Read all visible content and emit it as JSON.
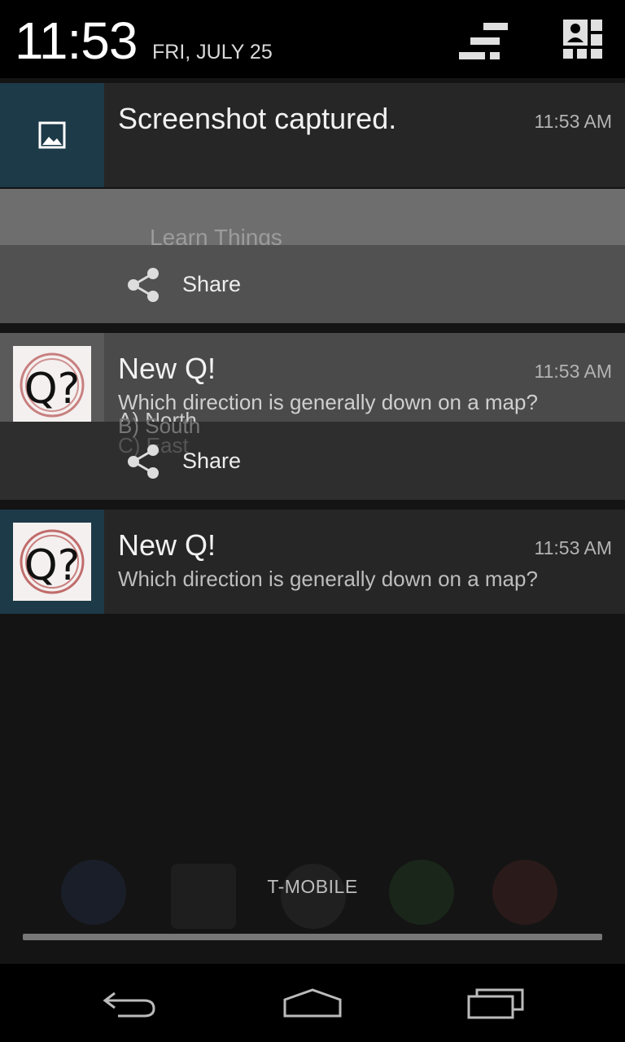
{
  "status": {
    "time": "11:53",
    "date": "FRI, JULY 25",
    "quick_settings_icon": "quick-settings-toggle-icon",
    "user_icon": "user-settings-icon"
  },
  "notifications": [
    {
      "type": "screenshot",
      "title": "Screenshot captured.",
      "time": "11:53 AM",
      "icon": "image-icon",
      "action_label": "Share",
      "action_icon": "share-icon"
    },
    {
      "type": "question",
      "title": "New Q!",
      "time": "11:53 AM",
      "body_lines": [
        "Which direction is generally down on a map?",
        "A) North",
        "B) South",
        "C) East"
      ],
      "icon": "q-app-icon",
      "action_label": "Share",
      "action_icon": "share-icon"
    },
    {
      "type": "question",
      "title": "New Q!",
      "time": "11:53 AM",
      "body": "Which direction is generally down on a map?",
      "icon": "q-app-icon"
    }
  ],
  "ghost_text": "Learn Things",
  "carrier": "T-MOBILE",
  "navbar": {
    "back_icon": "back-icon",
    "home_icon": "home-icon",
    "recents_icon": "recents-icon"
  },
  "colors": {
    "thumb_bg": "#1d3a48",
    "card_bg": "#262626",
    "action_bg": "#515151"
  }
}
